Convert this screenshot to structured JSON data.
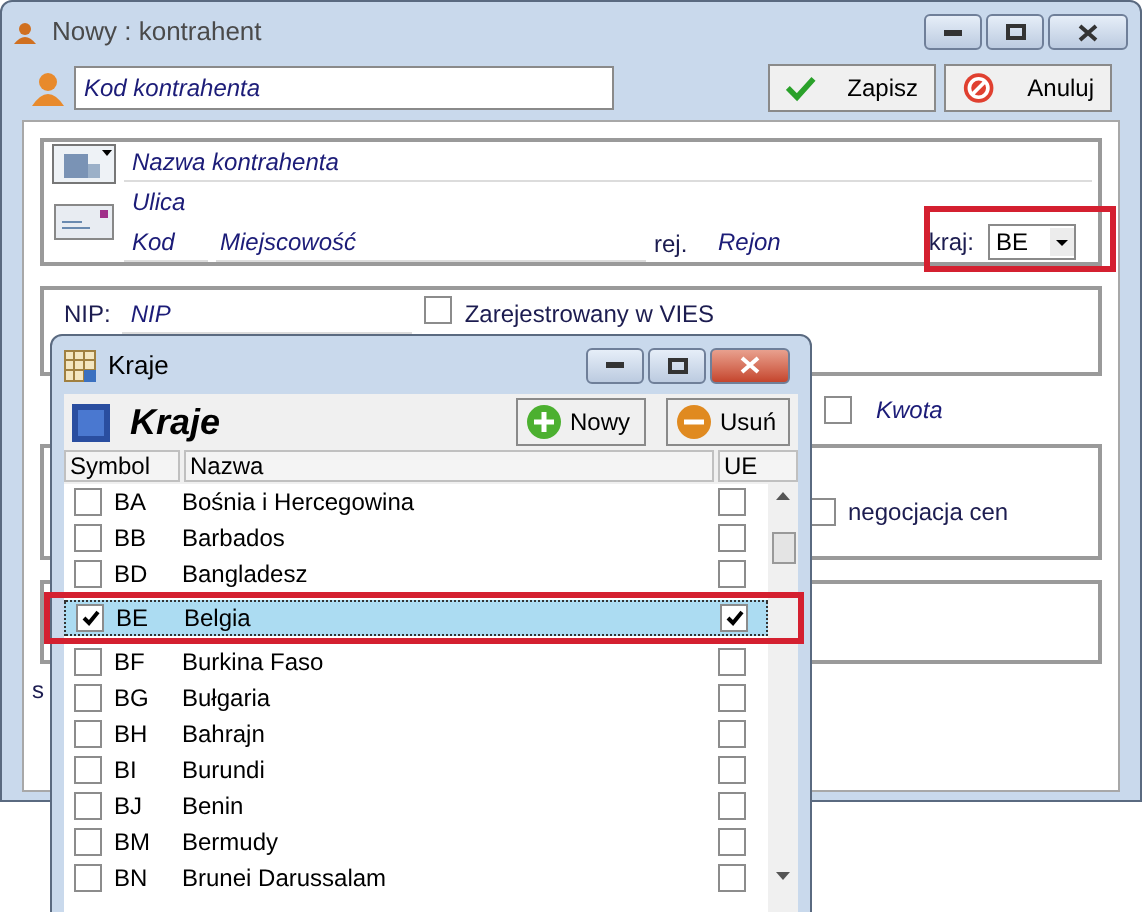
{
  "window": {
    "title": "Nowy : kontrahent"
  },
  "code_field": {
    "placeholder": "Kod kontrahenta"
  },
  "buttons": [
    {
      "kind": "save",
      "label": "Zapisz"
    },
    {
      "kind": "cancel",
      "label": "Anuluj"
    }
  ],
  "address": {
    "name_placeholder": "Nazwa kontrahenta",
    "street_placeholder": "Ulica",
    "postal_placeholder": "Kod",
    "city_placeholder": "Miejscowość",
    "region_label": "rej.",
    "region_placeholder": "Rejon",
    "country_label": "kraj:",
    "country": "BE"
  },
  "tax": {
    "nip_label": "NIP:",
    "nip_placeholder": "NIP",
    "vies": {
      "label": "Zarejestrowany w VIES",
      "checked": false
    }
  },
  "amount": {
    "checked": false,
    "placeholder": "Kwota"
  },
  "negotiation": {
    "checked": false,
    "label": "negocjacja cen"
  },
  "cut_label": "s",
  "dialog": {
    "title": "Kraje",
    "heading": "Kraje",
    "buttons": [
      {
        "kind": "add",
        "label": "Nowy"
      },
      {
        "kind": "remove",
        "label": "Usuń"
      }
    ],
    "columns": [
      "Symbol",
      "Nazwa",
      "UE"
    ],
    "rows": [
      {
        "symbol": "BA",
        "name": "Bośnia i Hercegowina",
        "checked": false,
        "eu": false,
        "selected": false
      },
      {
        "symbol": "BB",
        "name": "Barbados",
        "checked": false,
        "eu": false,
        "selected": false
      },
      {
        "symbol": "BD",
        "name": "Bangladesz",
        "checked": false,
        "eu": false,
        "selected": false
      },
      {
        "symbol": "BE",
        "name": "Belgia",
        "checked": true,
        "eu": true,
        "selected": true
      },
      {
        "symbol": "BF",
        "name": "Burkina Faso",
        "checked": false,
        "eu": false,
        "selected": false
      },
      {
        "symbol": "BG",
        "name": "Bułgaria",
        "checked": false,
        "eu": false,
        "selected": false
      },
      {
        "symbol": "BH",
        "name": "Bahrajn",
        "checked": false,
        "eu": false,
        "selected": false
      },
      {
        "symbol": "BI",
        "name": "Burundi",
        "checked": false,
        "eu": false,
        "selected": false
      },
      {
        "symbol": "BJ",
        "name": "Benin",
        "checked": false,
        "eu": false,
        "selected": false
      },
      {
        "symbol": "BM",
        "name": "Bermudy",
        "checked": false,
        "eu": false,
        "selected": false
      },
      {
        "symbol": "BN",
        "name": "Brunei Darussalam",
        "checked": false,
        "eu": false,
        "selected": false
      }
    ]
  }
}
